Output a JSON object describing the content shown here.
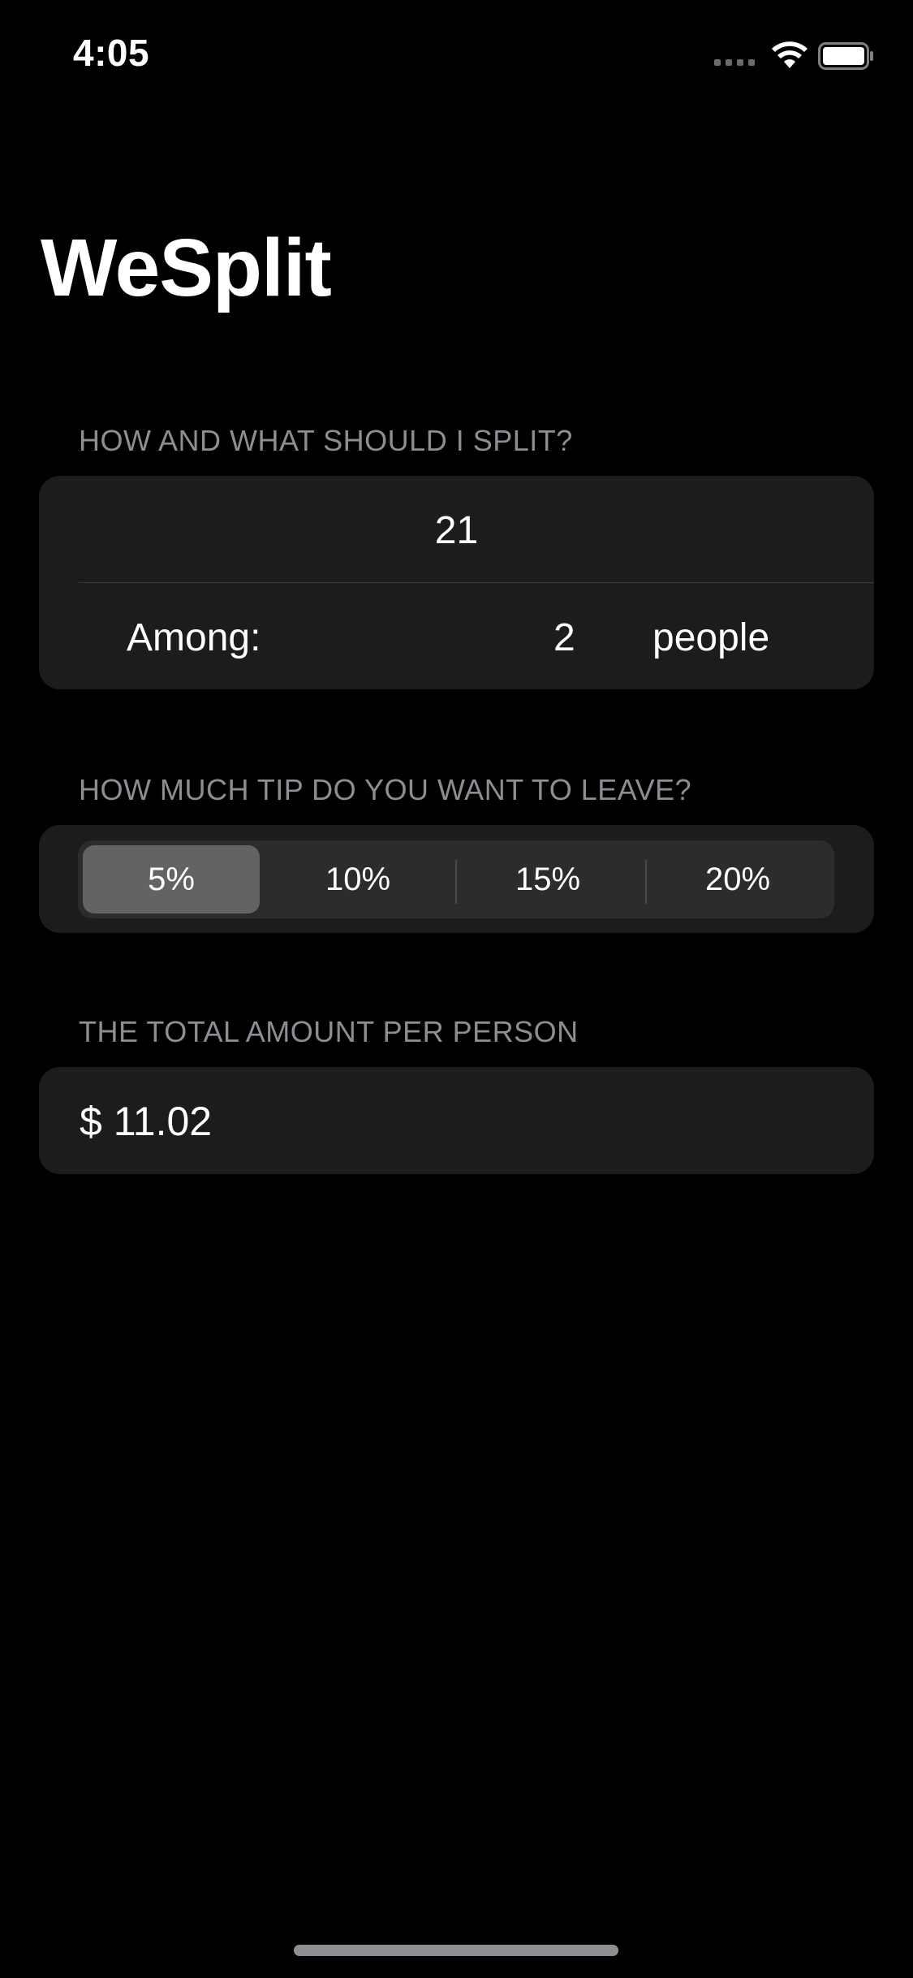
{
  "status_bar": {
    "time": "4:05"
  },
  "title": "WeSplit",
  "section_split": {
    "header": "HOW AND WHAT SHOULD I SPLIT?",
    "amount": "21",
    "among_label": "Among:",
    "people_count": "2",
    "people_unit": "people"
  },
  "section_tip": {
    "header": "HOW MUCH TIP DO YOU WANT TO LEAVE?",
    "options": [
      "5%",
      "10%",
      "15%",
      "20%"
    ],
    "selected": "5%"
  },
  "section_total": {
    "header": "THE TOTAL AMOUNT PER PERSON",
    "value": "$ 11.02"
  },
  "colors": {
    "background": "#000000",
    "card": "#1c1c1e",
    "segment_bg": "#2c2c2e",
    "segment_selected": "#636366",
    "header_text": "#8d8d93"
  }
}
